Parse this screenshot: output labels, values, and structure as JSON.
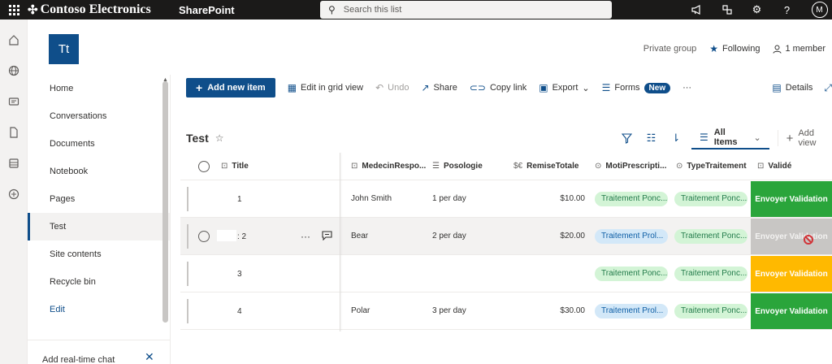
{
  "suite": {
    "brand": "Contoso Electronics",
    "app": "SharePoint",
    "search_placeholder": "Search this list",
    "avatar_initial": "M"
  },
  "site": {
    "logo_text": "Tt",
    "privacy": "Private group",
    "following": "Following",
    "members": "1 member"
  },
  "nav": {
    "items": [
      "Home",
      "Conversations",
      "Documents",
      "Notebook",
      "Pages",
      "Test",
      "Site contents",
      "Recycle bin"
    ],
    "edit": "Edit",
    "footer_text": "Add real-time chat"
  },
  "commands": {
    "add_new": "Add new item",
    "grid_view": "Edit in grid view",
    "undo": "Undo",
    "share": "Share",
    "copy_link": "Copy link",
    "export": "Export",
    "forms": "Forms",
    "new_badge": "New",
    "more": "···",
    "details": "Details"
  },
  "list": {
    "title": "Test",
    "view_name": "All Items",
    "add_view": "Add view",
    "columns": {
      "title": "Title",
      "medecin": "MedecinRespo...",
      "posologie": "Posologie",
      "remise": "RemiseTotale",
      "moti": "MotiPrescripti...",
      "type": "TypeTraitement",
      "valide": "Validé"
    },
    "rows": [
      {
        "title": "1",
        "medecin": "John Smith",
        "posologie": "1 per day",
        "remise": "$10.00",
        "moti": "Traitement Ponc...",
        "type": "Traitement Ponc...",
        "valide": "Envoyer Validation"
      },
      {
        "title": ": 2",
        "medecin": "Bear",
        "posologie": "2 per day",
        "remise": "$20.00",
        "moti": "Traitement Prol...",
        "type": "Traitement Ponc...",
        "valide": "Envoyer Validation"
      },
      {
        "title": "3",
        "medecin": "",
        "posologie": "",
        "remise": "",
        "moti": "Traitement Ponc...",
        "type": "Traitement Ponc...",
        "valide": "Envoyer Validation"
      },
      {
        "title": "4",
        "medecin": "Polar",
        "posologie": "3 per day",
        "remise": "$30.00",
        "moti": "Traitement Prol...",
        "type": "Traitement Ponc...",
        "valide": "Envoyer Validation"
      }
    ]
  },
  "colors": {
    "brand": "#0f4e8a",
    "valid_green": "#2aa53b",
    "valid_yellow": "#ffb900",
    "valid_disabled": "#c8c6c4"
  },
  "icons": [
    "waffle-icon",
    "search-icon",
    "megaphone-icon",
    "share-icon",
    "gear-icon",
    "help-icon",
    "home-icon",
    "globe-icon",
    "news-icon",
    "file-icon",
    "list-icon",
    "add-circle-icon",
    "star-icon",
    "person-icon",
    "plus-icon",
    "grid-icon",
    "undo-icon",
    "export-icon",
    "forms-icon",
    "details-icon",
    "filter-icon",
    "group-icon",
    "sort-icon",
    "view-icon",
    "close-icon",
    "no-entry-icon"
  ]
}
